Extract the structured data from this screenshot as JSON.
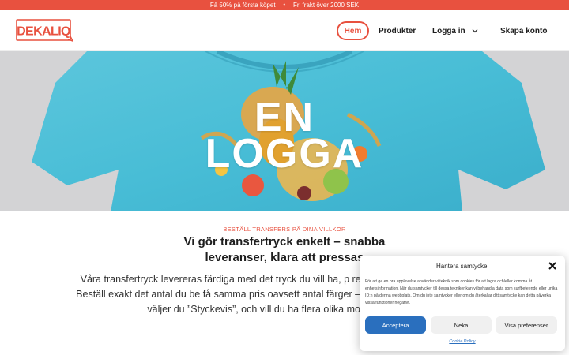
{
  "promo": {
    "left_text": "Få 50% på första köpet",
    "separator": "•",
    "right_text": "Fri frakt över 2000 SEK"
  },
  "brand": {
    "logo_text": "DEKALIQ",
    "accent_color": "#e8513f"
  },
  "nav": {
    "home": "Hem",
    "products": "Produkter",
    "login": "Logga in",
    "signup": "Skapa konto"
  },
  "hero": {
    "line1": "EN",
    "line2": "LOGGA"
  },
  "content": {
    "eyebrow": "BESTÄLL TRANSFERS PÅ DINA VILLKOR",
    "headline": "Vi gör transfertryck enkelt – snabba leveranser, klara att pressas",
    "body": "Våra transfertryck levereras färdiga med det tryck du vill ha, p redo att pressas i ett enda svep. Beställ exakt det antal du be få samma pris oavsett antal färger – fyrfärgstryck ingår. Vil motiv så väljer du ”Styckevis”, och vill du ha flera olika motiv och smidigt!"
  },
  "cookie": {
    "title": "Hantera samtycke",
    "text": "För att ge en bra upplevelse använder vi teknik som cookies för att lagra och/eller komma åt enhetsinformation. När du samtycker till dessa tekniker kan vi behandla data som surfbeteende eller unika ID:n på denna webbplats. Om du inte samtycker eller om du återkallar ditt samtycke kan detta påverka vissa funktioner negativt.",
    "accept": "Acceptera",
    "deny": "Neka",
    "preferences": "Visa preferenser",
    "policy": "Cookie Policy",
    "accept_color": "#2a6fbe"
  }
}
